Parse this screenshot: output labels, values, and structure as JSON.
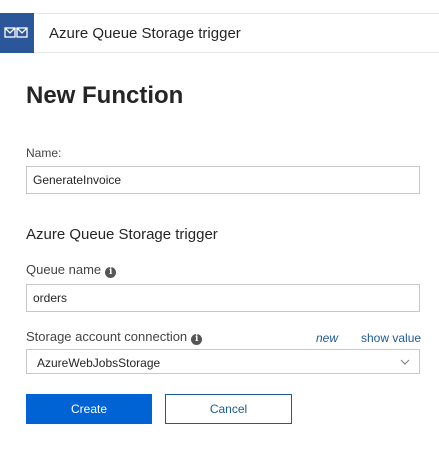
{
  "header": {
    "title": "Azure Queue Storage trigger",
    "icon": "queue-message-icon",
    "icon_bg_color": "#2b579a"
  },
  "page_title": "New Function",
  "name_field": {
    "label": "Name:",
    "value": "GenerateInvoice"
  },
  "section_heading": "Azure Queue Storage trigger",
  "queue_field": {
    "label": "Queue name",
    "value": "orders"
  },
  "storage_field": {
    "label": "Storage account connection",
    "new_link": "new",
    "show_value_link": "show value",
    "selected": "AzureWebJobsStorage"
  },
  "buttons": {
    "create": "Create",
    "cancel": "Cancel"
  },
  "colors": {
    "accent": "#0063d4",
    "link": "#1e5a96"
  }
}
